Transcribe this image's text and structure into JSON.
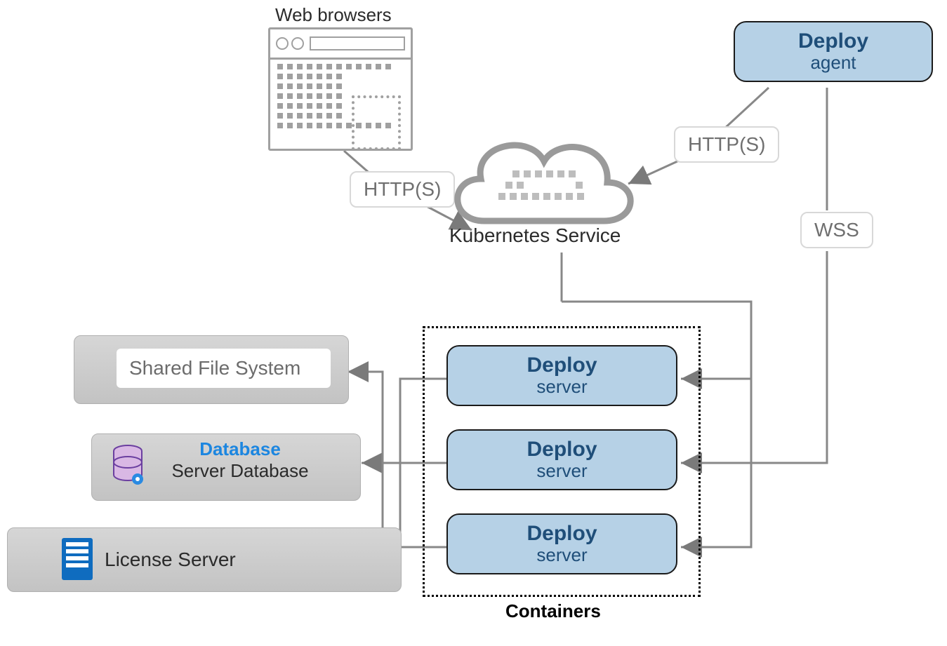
{
  "labels": {
    "web_browsers": "Web browsers",
    "https_left": "HTTP(S)",
    "https_right": "HTTP(S)",
    "wss": "WSS",
    "k8s_service": "Kubernetes Service",
    "containers": "Containers"
  },
  "deploy_agent": {
    "title": "Deploy",
    "sub": "agent"
  },
  "deploy_servers": [
    {
      "title": "Deploy",
      "sub": "server"
    },
    {
      "title": "Deploy",
      "sub": "server"
    },
    {
      "title": "Deploy",
      "sub": "server"
    }
  ],
  "shared_fs": "Shared File System",
  "database": {
    "title": "Database",
    "sub": "Server Database"
  },
  "license_server": "License Server"
}
